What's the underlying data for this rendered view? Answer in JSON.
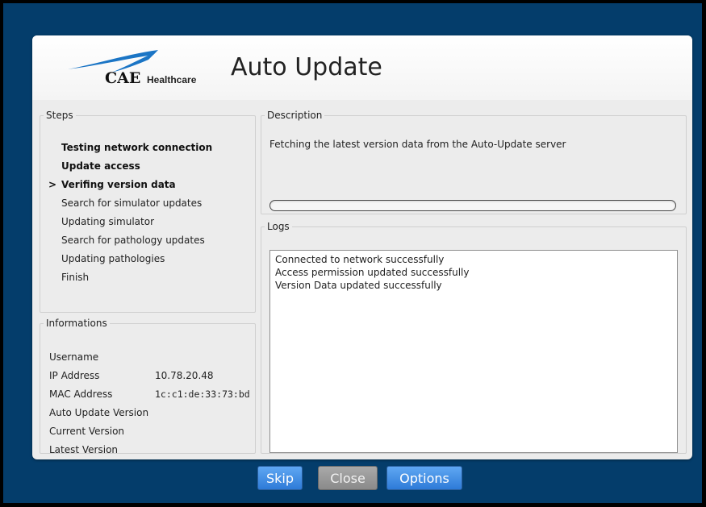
{
  "window": {
    "title": "Auto Update",
    "logo": {
      "brand": "CAE",
      "sub": "Healthcare"
    }
  },
  "steps": {
    "legend": "Steps",
    "current_marker": ">",
    "items": [
      {
        "label": "Testing network connection",
        "state": "done"
      },
      {
        "label": "Update access",
        "state": "done"
      },
      {
        "label": "Verifing version data",
        "state": "current"
      },
      {
        "label": "Search for simulator updates",
        "state": "pending"
      },
      {
        "label": "Updating simulator",
        "state": "pending"
      },
      {
        "label": "Search for pathology updates",
        "state": "pending"
      },
      {
        "label": "Updating pathologies",
        "state": "pending"
      },
      {
        "label": "Finish",
        "state": "pending"
      }
    ]
  },
  "informations": {
    "legend": "Informations",
    "rows": [
      {
        "label": "Username",
        "value": ""
      },
      {
        "label": "IP Address",
        "value": "10.78.20.48"
      },
      {
        "label": "MAC Address",
        "value": "1c:c1:de:33:73:bd"
      },
      {
        "label": "Auto Update Version",
        "value": ""
      },
      {
        "label": "Current Version",
        "value": ""
      },
      {
        "label": "Latest Version",
        "value": ""
      }
    ]
  },
  "description": {
    "legend": "Description",
    "text": "Fetching the latest version data from the Auto-Update server",
    "progress": 0
  },
  "logs": {
    "legend": "Logs",
    "lines": [
      "Connected to network successfully",
      "Access permission updated successfully",
      "Version Data updated successfully"
    ]
  },
  "buttons": {
    "skip": "Skip",
    "close": "Close",
    "options": "Options"
  },
  "colors": {
    "desktop_background": "#043d6b",
    "button_primary": "#3a88e0",
    "button_disabled": "#9a9a9a"
  },
  "icons": {
    "logo": "cae-swoosh-logo"
  }
}
